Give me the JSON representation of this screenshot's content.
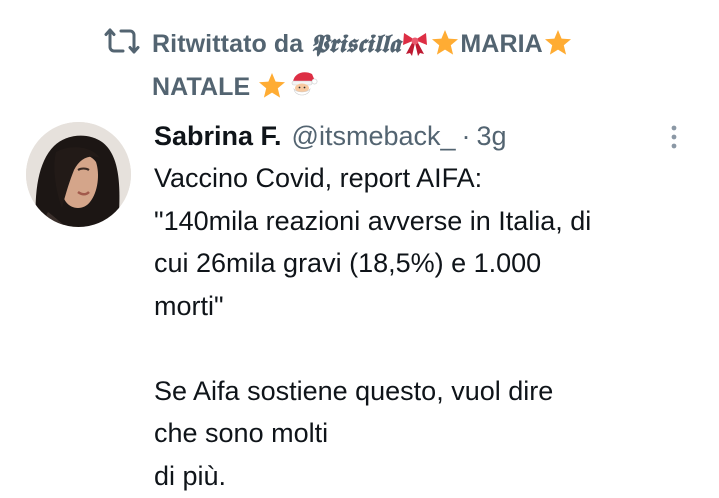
{
  "retweet": {
    "prefix": "Ritwittato da",
    "fancy_name": "𝕻𝖗𝖎𝖘𝖈𝖎𝖑𝖑𝖆",
    "name_part_1": "MARIA",
    "name_part_2": "NATALE",
    "icon": "retweet-icon"
  },
  "tweet": {
    "display_name": "Sabrina F.",
    "handle": "@itsmeback_",
    "separator": "·",
    "time": "3g",
    "lines": [
      "Vaccino Covid, report AIFA:",
      "\"140mila reazioni avverse in Italia, di",
      "cui 26mila gravi (18,5%) e 1.000",
      "morti\"",
      "",
      "Se Aifa sostiene questo, vuol dire",
      "che sono molti",
      "di più."
    ]
  },
  "colors": {
    "text": "#0f1419",
    "secondary": "#536471",
    "star": "#f4b400",
    "ribbon": "#e0245e"
  }
}
